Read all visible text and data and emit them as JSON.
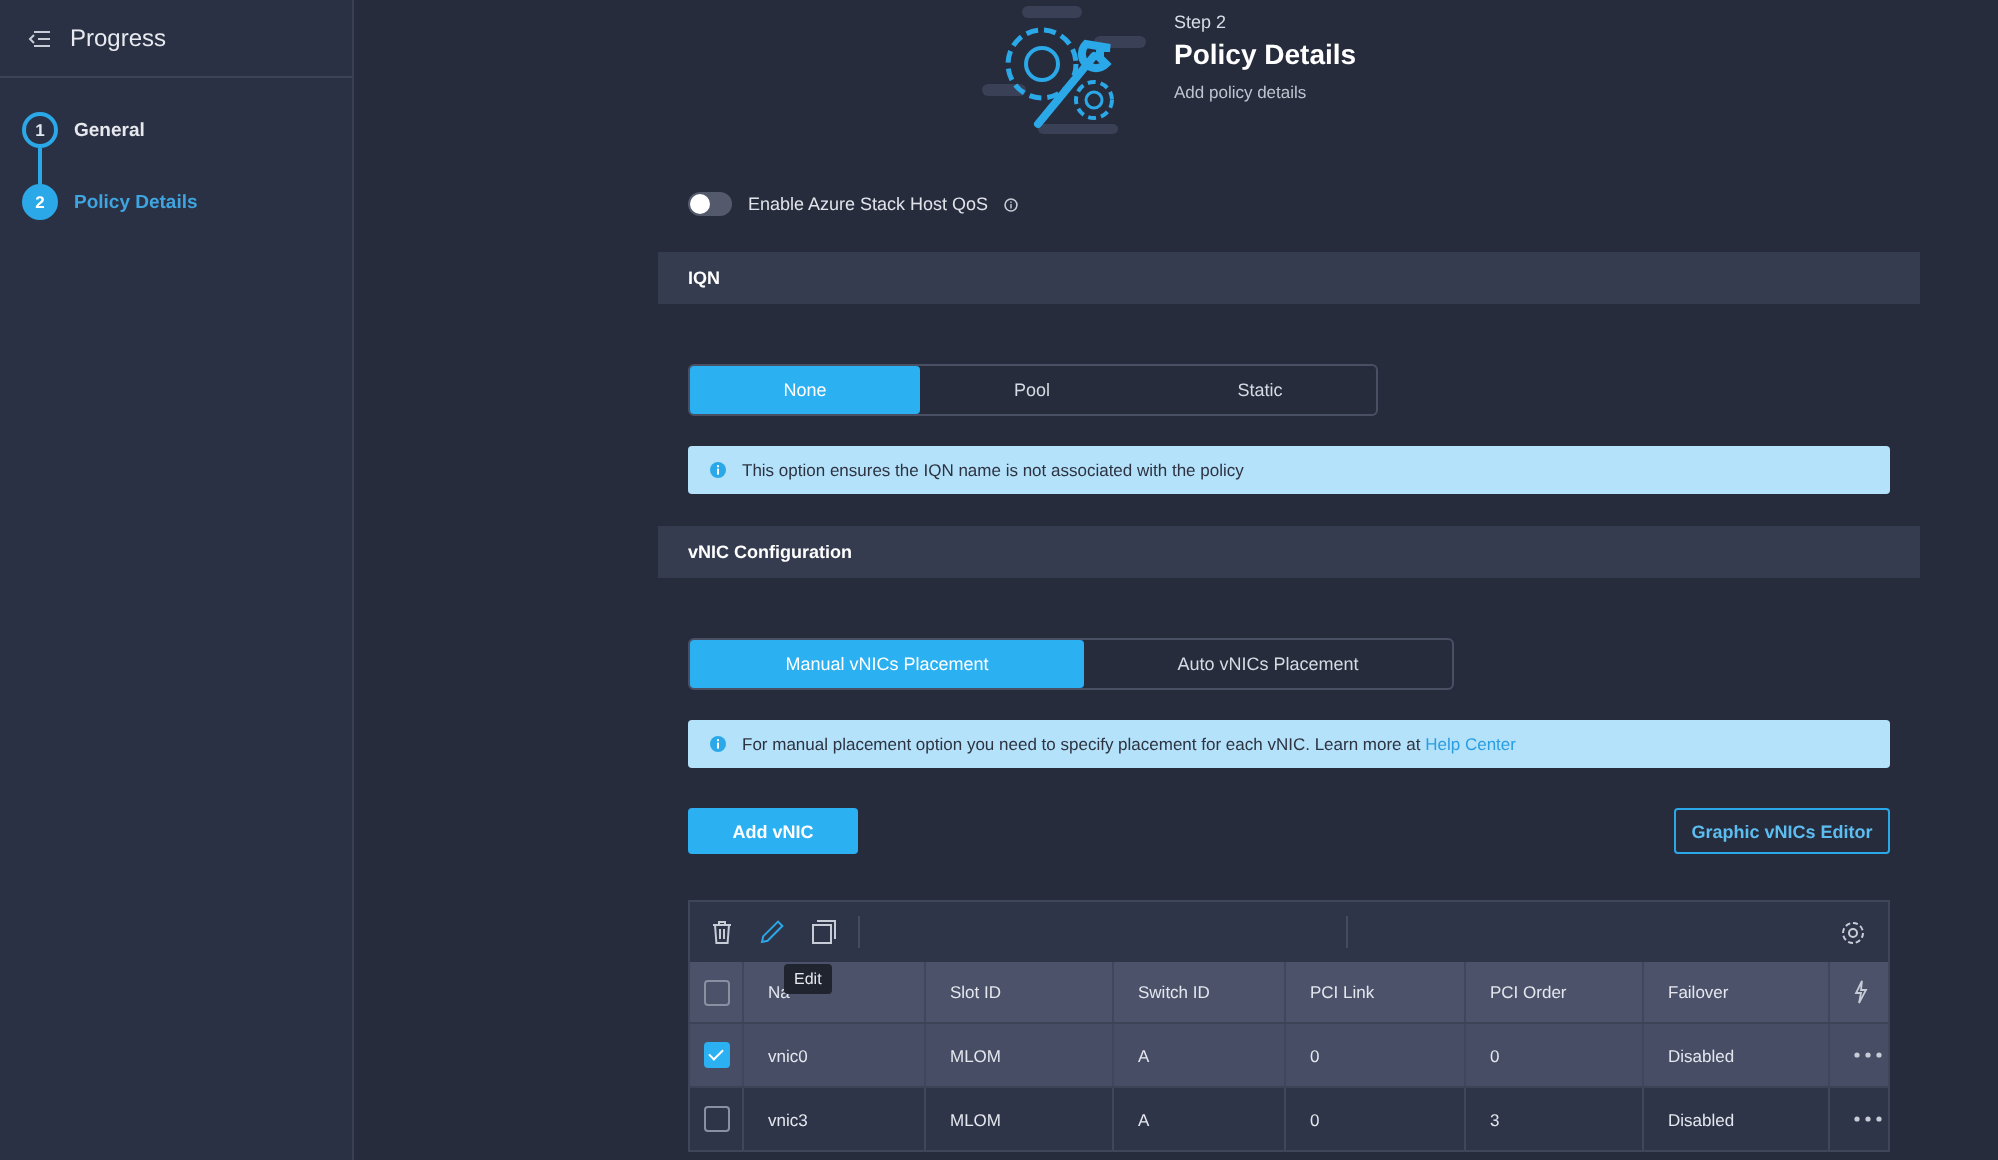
{
  "sidebar": {
    "title": "Progress",
    "steps": [
      {
        "number": "1",
        "label": "General",
        "selected": false
      },
      {
        "number": "2",
        "label": "Policy Details",
        "selected": true
      }
    ]
  },
  "header": {
    "step": "Step 2",
    "title": "Policy Details",
    "subtitle": "Add policy details"
  },
  "toggle": {
    "label": "Enable Azure Stack Host QoS",
    "on": false
  },
  "iqn": {
    "title": "IQN",
    "options": [
      {
        "label": "None",
        "selected": true
      },
      {
        "label": "Pool",
        "selected": false
      },
      {
        "label": "Static",
        "selected": false
      }
    ],
    "info": "This option ensures the IQN name is not associated with the policy"
  },
  "vnic": {
    "title": "vNIC Configuration",
    "options": [
      {
        "label": "Manual vNICs Placement",
        "selected": true
      },
      {
        "label": "Auto vNICs Placement",
        "selected": false
      }
    ],
    "info": "For manual placement option you need to specify placement for each vNIC. Learn more at",
    "info_link": "Help Center",
    "add_button": "Add vNIC",
    "editor_button": "Graphic vNICs Editor"
  },
  "table": {
    "tooltip": "Edit",
    "columns": [
      "Na",
      "Slot ID",
      "Switch ID",
      "PCI Link",
      "PCI Order",
      "Failover"
    ],
    "header_checked": false,
    "rows": [
      {
        "selected": true,
        "cells": [
          "vnic0",
          "MLOM",
          "A",
          "0",
          "0",
          "Disabled"
        ]
      },
      {
        "selected": false,
        "cells": [
          "vnic3",
          "MLOM",
          "A",
          "0",
          "3",
          "Disabled"
        ]
      }
    ]
  }
}
